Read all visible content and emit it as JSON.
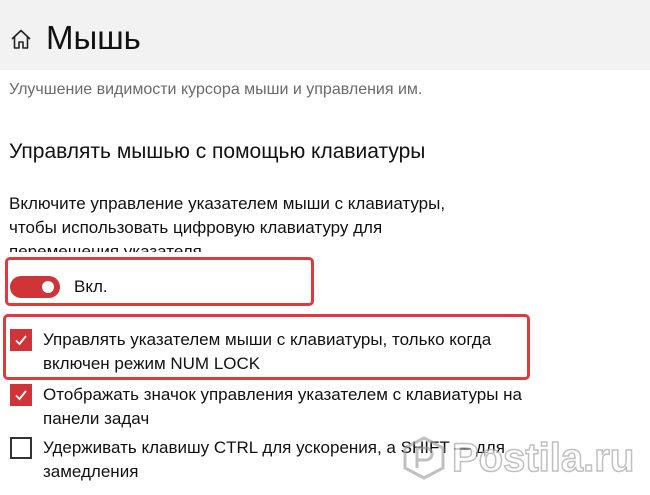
{
  "header": {
    "title": "Мышь",
    "home_icon": "home-icon"
  },
  "description": "Улучшение видимости курсора мыши и управления им.",
  "section": {
    "title": "Управлять мышью с помощью клавиатуры",
    "intro": "Включите управление указателем мыши с клавиатуры, чтобы использовать цифровую клавиатуру для перемещения указателя"
  },
  "toggle": {
    "state": "on",
    "label": "Вкл."
  },
  "options": [
    {
      "label": "Управлять указателем мыши с клавиатуры, только когда включен режим NUM LOCK",
      "checked": true
    },
    {
      "label": "Отображать значок управления указателем с клавиатуры на панели задач",
      "checked": true
    },
    {
      "label": "Удерживать клавишу CTRL для ускорения, а SHIFT — для замедления",
      "checked": false
    }
  ],
  "watermark": {
    "text": "Postila.ru"
  },
  "colors": {
    "accent": "#d13438",
    "highlight": "#e0393e",
    "header_bg": "#f2f2f2",
    "description": "#6a6a6a"
  }
}
